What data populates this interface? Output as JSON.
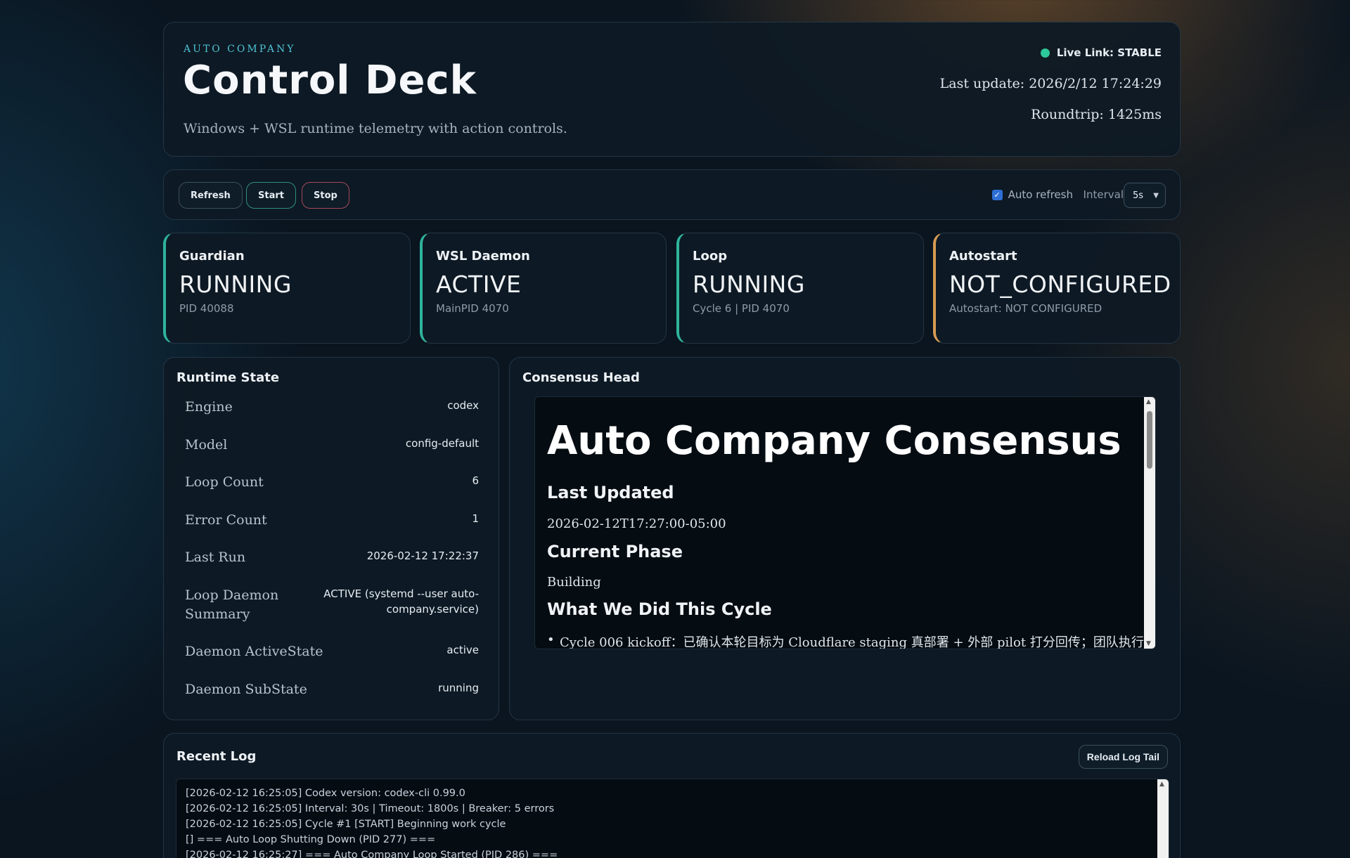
{
  "header": {
    "brand": "AUTO COMPANY",
    "title": "Control Deck",
    "subtitle": "Windows + WSL runtime telemetry with action controls.",
    "live_link": "Live Link: STABLE",
    "last_update": "Last update: 2026/2/12 17:24:29",
    "roundtrip": "Roundtrip: 1425ms"
  },
  "toolbar": {
    "refresh_label": "Refresh",
    "start_label": "Start",
    "stop_label": "Stop",
    "auto_refresh_label": "Auto refresh",
    "auto_refresh_checked": true,
    "interval_label": "Interval",
    "interval_value": "5s"
  },
  "cards": [
    {
      "title": "Guardian",
      "value": "RUNNING",
      "sub": "PID 40088",
      "status": "ok"
    },
    {
      "title": "WSL Daemon",
      "value": "ACTIVE",
      "sub": "MainPID 4070",
      "status": "ok"
    },
    {
      "title": "Loop",
      "value": "RUNNING",
      "sub": "Cycle 6 | PID 4070",
      "status": "ok"
    },
    {
      "title": "Autostart",
      "value": "NOT_CONFIGURED",
      "sub": "Autostart: NOT CONFIGURED",
      "status": "warn"
    }
  ],
  "runtime": {
    "title": "Runtime State",
    "rows": [
      {
        "label": "Engine",
        "value": "codex"
      },
      {
        "label": "Model",
        "value": "config-default"
      },
      {
        "label": "Loop Count",
        "value": "6"
      },
      {
        "label": "Error Count",
        "value": "1"
      },
      {
        "label": "Last Run",
        "value": "2026-02-12 17:22:37"
      },
      {
        "label": "Loop Daemon Summary",
        "value": "ACTIVE (systemd --user auto-company.service)"
      },
      {
        "label": "Daemon ActiveState",
        "value": "active"
      },
      {
        "label": "Daemon SubState",
        "value": "running"
      }
    ]
  },
  "consensus": {
    "title": "Consensus Head",
    "heading": "Auto Company Consensus",
    "last_updated_heading": "Last Updated",
    "last_updated_value": "2026-02-12T17:27:00-05:00",
    "phase_heading": "Current Phase",
    "phase_value": "Building",
    "cycle_heading": "What We Did This Cycle",
    "cycle_item": "Cycle 006 kickoff：已确认本轮目标为 Cloudflare staging 真部署 + 外部 pilot 打分回传；团队执行"
  },
  "recent_log": {
    "title": "Recent Log",
    "reload_label": "Reload Log Tail",
    "lines": [
      "[2026-02-12 16:25:05] Codex version: codex-cli 0.99.0",
      "[2026-02-12 16:25:05] Interval: 30s | Timeout: 1800s | Breaker: 5 errors",
      "[2026-02-12 16:25:05] Cycle #1 [START] Beginning work cycle",
      "[] === Auto Loop Shutting Down (PID 277) ===",
      "[2026-02-12 16:25:27] === Auto Company Loop Started (PID 286) ==="
    ]
  },
  "colors": {
    "accent": "#4fc3d6",
    "ok": "#2fb39c",
    "warn": "#d69a52",
    "live": "#2ec99a",
    "stop": "#a54a5a"
  }
}
